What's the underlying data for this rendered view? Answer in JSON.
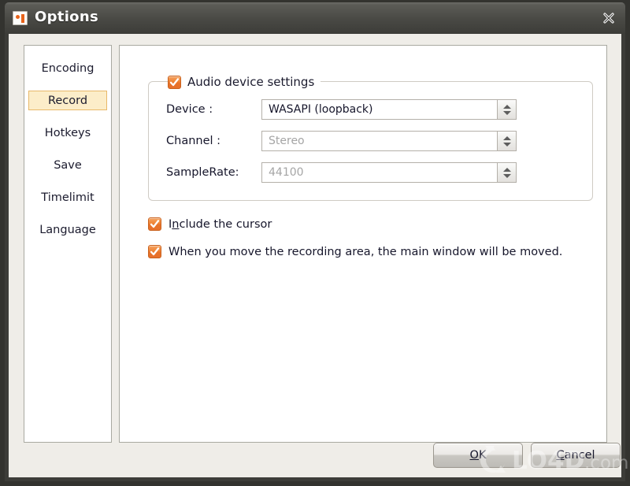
{
  "window": {
    "title": "Options",
    "icon": "app-logo-icon",
    "close_label": "✕"
  },
  "sidebar": {
    "items": [
      {
        "label": "Encoding",
        "selected": false
      },
      {
        "label": "Record",
        "selected": true
      },
      {
        "label": "Hotkeys",
        "selected": false
      },
      {
        "label": "Save",
        "selected": false
      },
      {
        "label": "Timelimit",
        "selected": false
      },
      {
        "label": "Language",
        "selected": false
      }
    ]
  },
  "main": {
    "group": {
      "title": "Audio device settings",
      "checked": true,
      "rows": [
        {
          "label": "Device :",
          "value": "WASAPI (loopback)",
          "disabled": false
        },
        {
          "label": "Channel :",
          "value": "Stereo",
          "disabled": true
        },
        {
          "label": "SampleRate:",
          "value": "44100",
          "disabled": true
        }
      ]
    },
    "options": [
      {
        "pre": "I",
        "accel": "n",
        "post": "clude the cursor",
        "checked": true
      },
      {
        "pre": "When you move the recording area, the main window will be moved.",
        "accel": "",
        "post": "",
        "checked": true
      }
    ]
  },
  "footer": {
    "ok": {
      "pre": "",
      "accel": "O",
      "post": "K"
    },
    "cancel": {
      "pre": "",
      "accel": "C",
      "post": "ancel"
    }
  },
  "watermark": {
    "bold": "LO4D",
    "light": ".com"
  },
  "colors": {
    "accent_orange": "#e7722a",
    "titlebar_dark": "#49494a",
    "selected_tab_fill": "#fcedc9",
    "selected_tab_border": "#e8b86a",
    "panel_bg": "#ffffff",
    "client_bg": "#efede8"
  }
}
